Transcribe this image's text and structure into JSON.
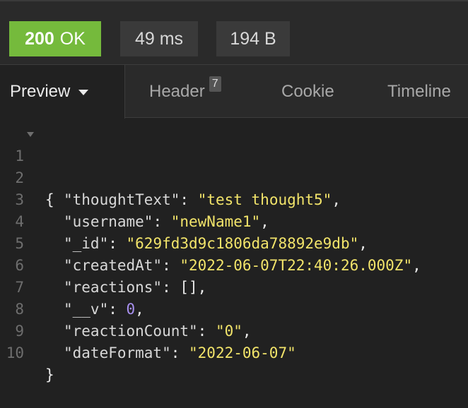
{
  "status": {
    "code": "200",
    "text": "OK",
    "time": "49 ms",
    "size": "194 B"
  },
  "tabs": {
    "preview": "Preview",
    "header": "Header",
    "header_count": "7",
    "cookie": "Cookie",
    "timeline": "Timeline"
  },
  "code": {
    "line_numbers": [
      "1",
      "2",
      "3",
      "4",
      "5",
      "6",
      "7",
      "8",
      "9",
      "10"
    ],
    "open_brace": "{",
    "close_brace": "}",
    "fields": [
      {
        "key": "\"thoughtText\"",
        "value": "\"test thought5\"",
        "type": "string"
      },
      {
        "key": "\"username\"",
        "value": "\"newName1\"",
        "type": "string"
      },
      {
        "key": "\"_id\"",
        "value": "\"629fd3d9c1806da78892e9db\"",
        "type": "string"
      },
      {
        "key": "\"createdAt\"",
        "value": "\"2022-06-07T22:40:26.000Z\"",
        "type": "string"
      },
      {
        "key": "\"reactions\"",
        "value": "[]",
        "type": "array"
      },
      {
        "key": "\"__v\"",
        "value": "0",
        "type": "number"
      },
      {
        "key": "\"reactionCount\"",
        "value": "\"0\"",
        "type": "string"
      },
      {
        "key": "\"dateFormat\"",
        "value": "\"2022-06-07\"",
        "type": "string"
      }
    ]
  },
  "colors": {
    "status_ok": "#75ba3c",
    "string": "#f2e46a",
    "number": "#a890f0",
    "background": "#212121"
  }
}
